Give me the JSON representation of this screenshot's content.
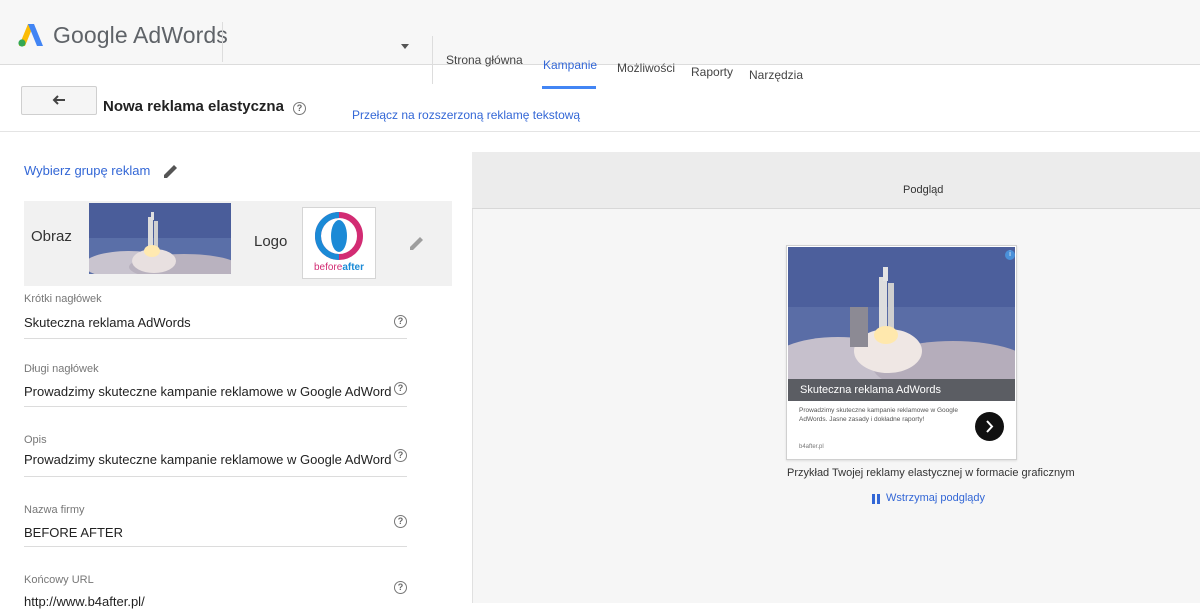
{
  "header": {
    "brand": "Google AdWords",
    "tabs": [
      {
        "label": "Strona główna",
        "active": false
      },
      {
        "label": "Kampanie",
        "active": true
      },
      {
        "label": "Możliwości",
        "active": false
      },
      {
        "label": "Raporty",
        "active": false
      },
      {
        "label": "Narzędzia",
        "active": false
      }
    ]
  },
  "subheader": {
    "title": "Nowa reklama elastyczna",
    "switch_link": "Przełącz na rozszerzoną reklamę tekstową"
  },
  "form": {
    "choose_group": "Wybierz grupę reklam",
    "image_label": "Obraz",
    "logo_label": "Logo",
    "logo_text_before": "before",
    "logo_text_after": "after",
    "fields": [
      {
        "label": "Krótki nagłówek",
        "value": "Skuteczna reklama AdWords"
      },
      {
        "label": "Długi nagłówek",
        "value": "Prowadzimy skuteczne kampanie reklamowe w Google AdWords"
      },
      {
        "label": "Opis",
        "value": "Prowadzimy skuteczne kampanie reklamowe w Google AdWords"
      },
      {
        "label": "Nazwa firmy",
        "value": "BEFORE AFTER"
      },
      {
        "label": "Końcowy URL",
        "value": "http://www.b4after.pl/"
      }
    ]
  },
  "preview": {
    "title": "Podgląd",
    "ad": {
      "headline": "Skuteczna reklama AdWords",
      "description": "Prowadzimy skuteczne kampanie reklamowe w Google AdWords. Jasne zasady i dokładne raporty!",
      "domain": "b4after.pl"
    },
    "caption": "Przykład Twojej reklamy elastycznej w formacie graficznym",
    "pause_link": "Wstrzymaj podglądy"
  },
  "colors": {
    "link": "#3367d6",
    "active_tab_underline": "#4285f4",
    "logo_blue": "#4285f4",
    "logo_yellow": "#fbbc05",
    "logo_green": "#34a853"
  }
}
